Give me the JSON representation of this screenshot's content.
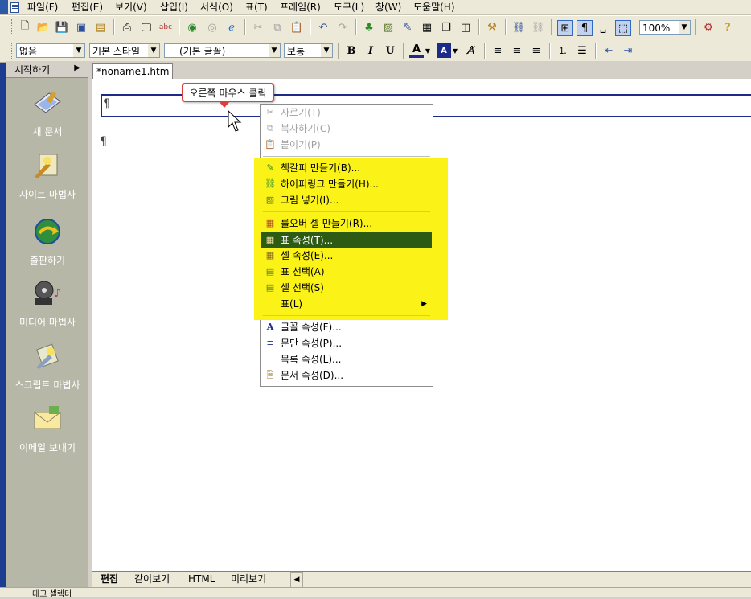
{
  "menubar": {
    "items": [
      "파일(F)",
      "편집(E)",
      "보기(V)",
      "삽입(I)",
      "서식(O)",
      "표(T)",
      "프레임(R)",
      "도구(L)",
      "창(W)",
      "도움말(H)"
    ]
  },
  "toolbar2": {
    "style_value": "없음",
    "paragraph_style_value": "기본 스타일",
    "font_value": "(기본 글꼴)",
    "size_value": "보통",
    "zoom_value": "100%"
  },
  "sidebar": {
    "header": "시작하기",
    "items": [
      {
        "label": "새 문서",
        "icon": "new-document-icon"
      },
      {
        "label": "사이트 마법사",
        "icon": "site-wizard-icon"
      },
      {
        "label": "출판하기",
        "icon": "publish-icon"
      },
      {
        "label": "미디어 마법사",
        "icon": "media-wizard-icon"
      },
      {
        "label": "스크립트 마법사",
        "icon": "script-wizard-icon"
      },
      {
        "label": "이메일 보내기",
        "icon": "send-email-icon"
      }
    ]
  },
  "document": {
    "tab_label": "*noname1.htm",
    "pilcrow": "¶"
  },
  "callout": {
    "text": "오른쪽 마우스 클릭"
  },
  "context_menu": {
    "items": [
      {
        "label": "자르기(T)",
        "disabled": true
      },
      {
        "label": "복사하기(C)",
        "disabled": true
      },
      {
        "label": "붙이기(P)",
        "disabled": true
      },
      {
        "label": "책갈피 만들기(B)..."
      },
      {
        "label": "하이퍼링크 만들기(H)..."
      },
      {
        "label": "그림 넣기(I)..."
      },
      {
        "label": "롤오버 셀 만들기(R)..."
      },
      {
        "label": "표 속성(T)...",
        "selected": true
      },
      {
        "label": "셀 속성(E)..."
      },
      {
        "label": "표 선택(A)"
      },
      {
        "label": "셀 선택(S)"
      },
      {
        "label": "표(L)",
        "submenu": true
      },
      {
        "label": "글꼴 속성(F)..."
      },
      {
        "label": "문단 속성(P)..."
      },
      {
        "label": "목록 속성(L)..."
      },
      {
        "label": "문서 속성(D)..."
      }
    ]
  },
  "bottom_tabs": [
    "편집",
    "같이보기",
    "HTML",
    "미리보기"
  ],
  "statusbar": {
    "text": "태그 셀렉터"
  },
  "colors": {
    "highlight": "#fbf218",
    "selected_item": "#2e5b14",
    "callout_border": "#d9413b",
    "sidebar_bg": "#b7b7a7"
  }
}
